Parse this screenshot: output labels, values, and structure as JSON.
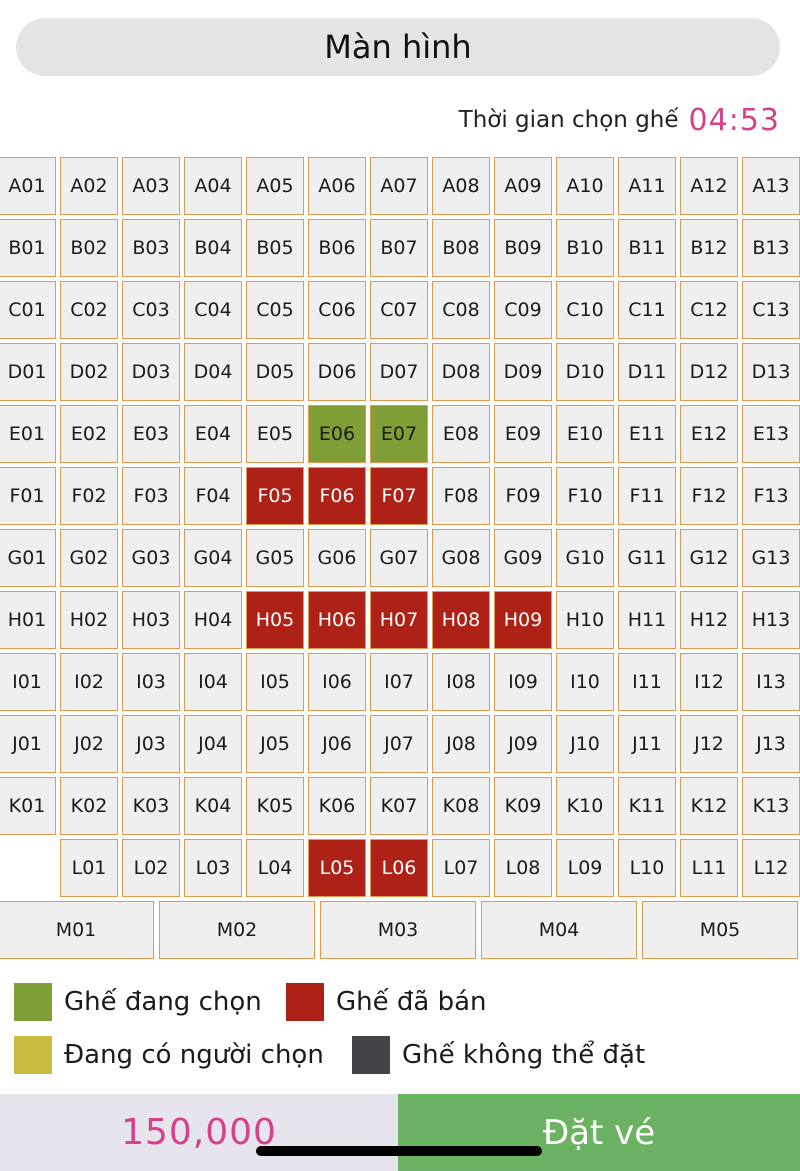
{
  "screen_label": "Màn hình",
  "timer": {
    "label": "Thời gian chọn ghế",
    "value": "04:53"
  },
  "seat_rows": [
    {
      "row": "A",
      "offset": 0,
      "seats": [
        "A01",
        "A02",
        "A03",
        "A04",
        "A05",
        "A06",
        "A07",
        "A08",
        "A09",
        "A10",
        "A11",
        "A12",
        "A13"
      ]
    },
    {
      "row": "B",
      "offset": 0,
      "seats": [
        "B01",
        "B02",
        "B03",
        "B04",
        "B05",
        "B06",
        "B07",
        "B08",
        "B09",
        "B10",
        "B11",
        "B12",
        "B13"
      ]
    },
    {
      "row": "C",
      "offset": 0,
      "seats": [
        "C01",
        "C02",
        "C03",
        "C04",
        "C05",
        "C06",
        "C07",
        "C08",
        "C09",
        "C10",
        "C11",
        "C12",
        "C13"
      ]
    },
    {
      "row": "D",
      "offset": 0,
      "seats": [
        "D01",
        "D02",
        "D03",
        "D04",
        "D05",
        "D06",
        "D07",
        "D08",
        "D09",
        "D10",
        "D11",
        "D12",
        "D13"
      ]
    },
    {
      "row": "E",
      "offset": 0,
      "seats": [
        "E01",
        "E02",
        "E03",
        "E04",
        "E05",
        "E06",
        "E07",
        "E08",
        "E09",
        "E10",
        "E11",
        "E12",
        "E13"
      ]
    },
    {
      "row": "F",
      "offset": 0,
      "seats": [
        "F01",
        "F02",
        "F03",
        "F04",
        "F05",
        "F06",
        "F07",
        "F08",
        "F09",
        "F10",
        "F11",
        "F12",
        "F13"
      ]
    },
    {
      "row": "G",
      "offset": 0,
      "seats": [
        "G01",
        "G02",
        "G03",
        "G04",
        "G05",
        "G06",
        "G07",
        "G08",
        "G09",
        "G10",
        "G11",
        "G12",
        "G13"
      ]
    },
    {
      "row": "H",
      "offset": 0,
      "seats": [
        "H01",
        "H02",
        "H03",
        "H04",
        "H05",
        "H06",
        "H07",
        "H08",
        "H09",
        "H10",
        "H11",
        "H12",
        "H13"
      ]
    },
    {
      "row": "I",
      "offset": 0,
      "seats": [
        "I01",
        "I02",
        "I03",
        "I04",
        "I05",
        "I06",
        "I07",
        "I08",
        "I09",
        "I10",
        "I11",
        "I12",
        "I13"
      ]
    },
    {
      "row": "J",
      "offset": 0,
      "seats": [
        "J01",
        "J02",
        "J03",
        "J04",
        "J05",
        "J06",
        "J07",
        "J08",
        "J09",
        "J10",
        "J11",
        "J12",
        "J13"
      ]
    },
    {
      "row": "K",
      "offset": 0,
      "seats": [
        "K01",
        "K02",
        "K03",
        "K04",
        "K05",
        "K06",
        "K07",
        "K08",
        "K09",
        "K10",
        "K11",
        "K12",
        "K13"
      ]
    },
    {
      "row": "L",
      "offset": 1,
      "seats": [
        "L01",
        "L02",
        "L03",
        "L04",
        "L05",
        "L06",
        "L07",
        "L08",
        "L09",
        "L10",
        "L11",
        "L12"
      ]
    }
  ],
  "wide_row": {
    "row": "M",
    "seats": [
      "M01",
      "M02",
      "M03",
      "M04",
      "M05"
    ]
  },
  "seat_status": {
    "selected": [
      "E06",
      "E07"
    ],
    "sold": [
      "F05",
      "F06",
      "F07",
      "H05",
      "H06",
      "H07",
      "H08",
      "H09",
      "L05",
      "L06"
    ],
    "holding": [],
    "blocked": []
  },
  "legend": [
    {
      "key": "selected",
      "label": "Ghế đang chọn",
      "color": "#7f9e35"
    },
    {
      "key": "sold",
      "label": "Ghế đã bán",
      "color": "#ad2116"
    },
    {
      "key": "holding",
      "label": "Đang có người chọn",
      "color": "#c8bd3f"
    },
    {
      "key": "blocked",
      "label": "Ghế không thể đặt",
      "color": "#444448"
    }
  ],
  "colors": {
    "accent": "#d6418a",
    "book_button": "#6bb362",
    "seat_border": "#e39a4e"
  },
  "footer": {
    "price": "150,000",
    "book_label": "Đặt vé"
  }
}
